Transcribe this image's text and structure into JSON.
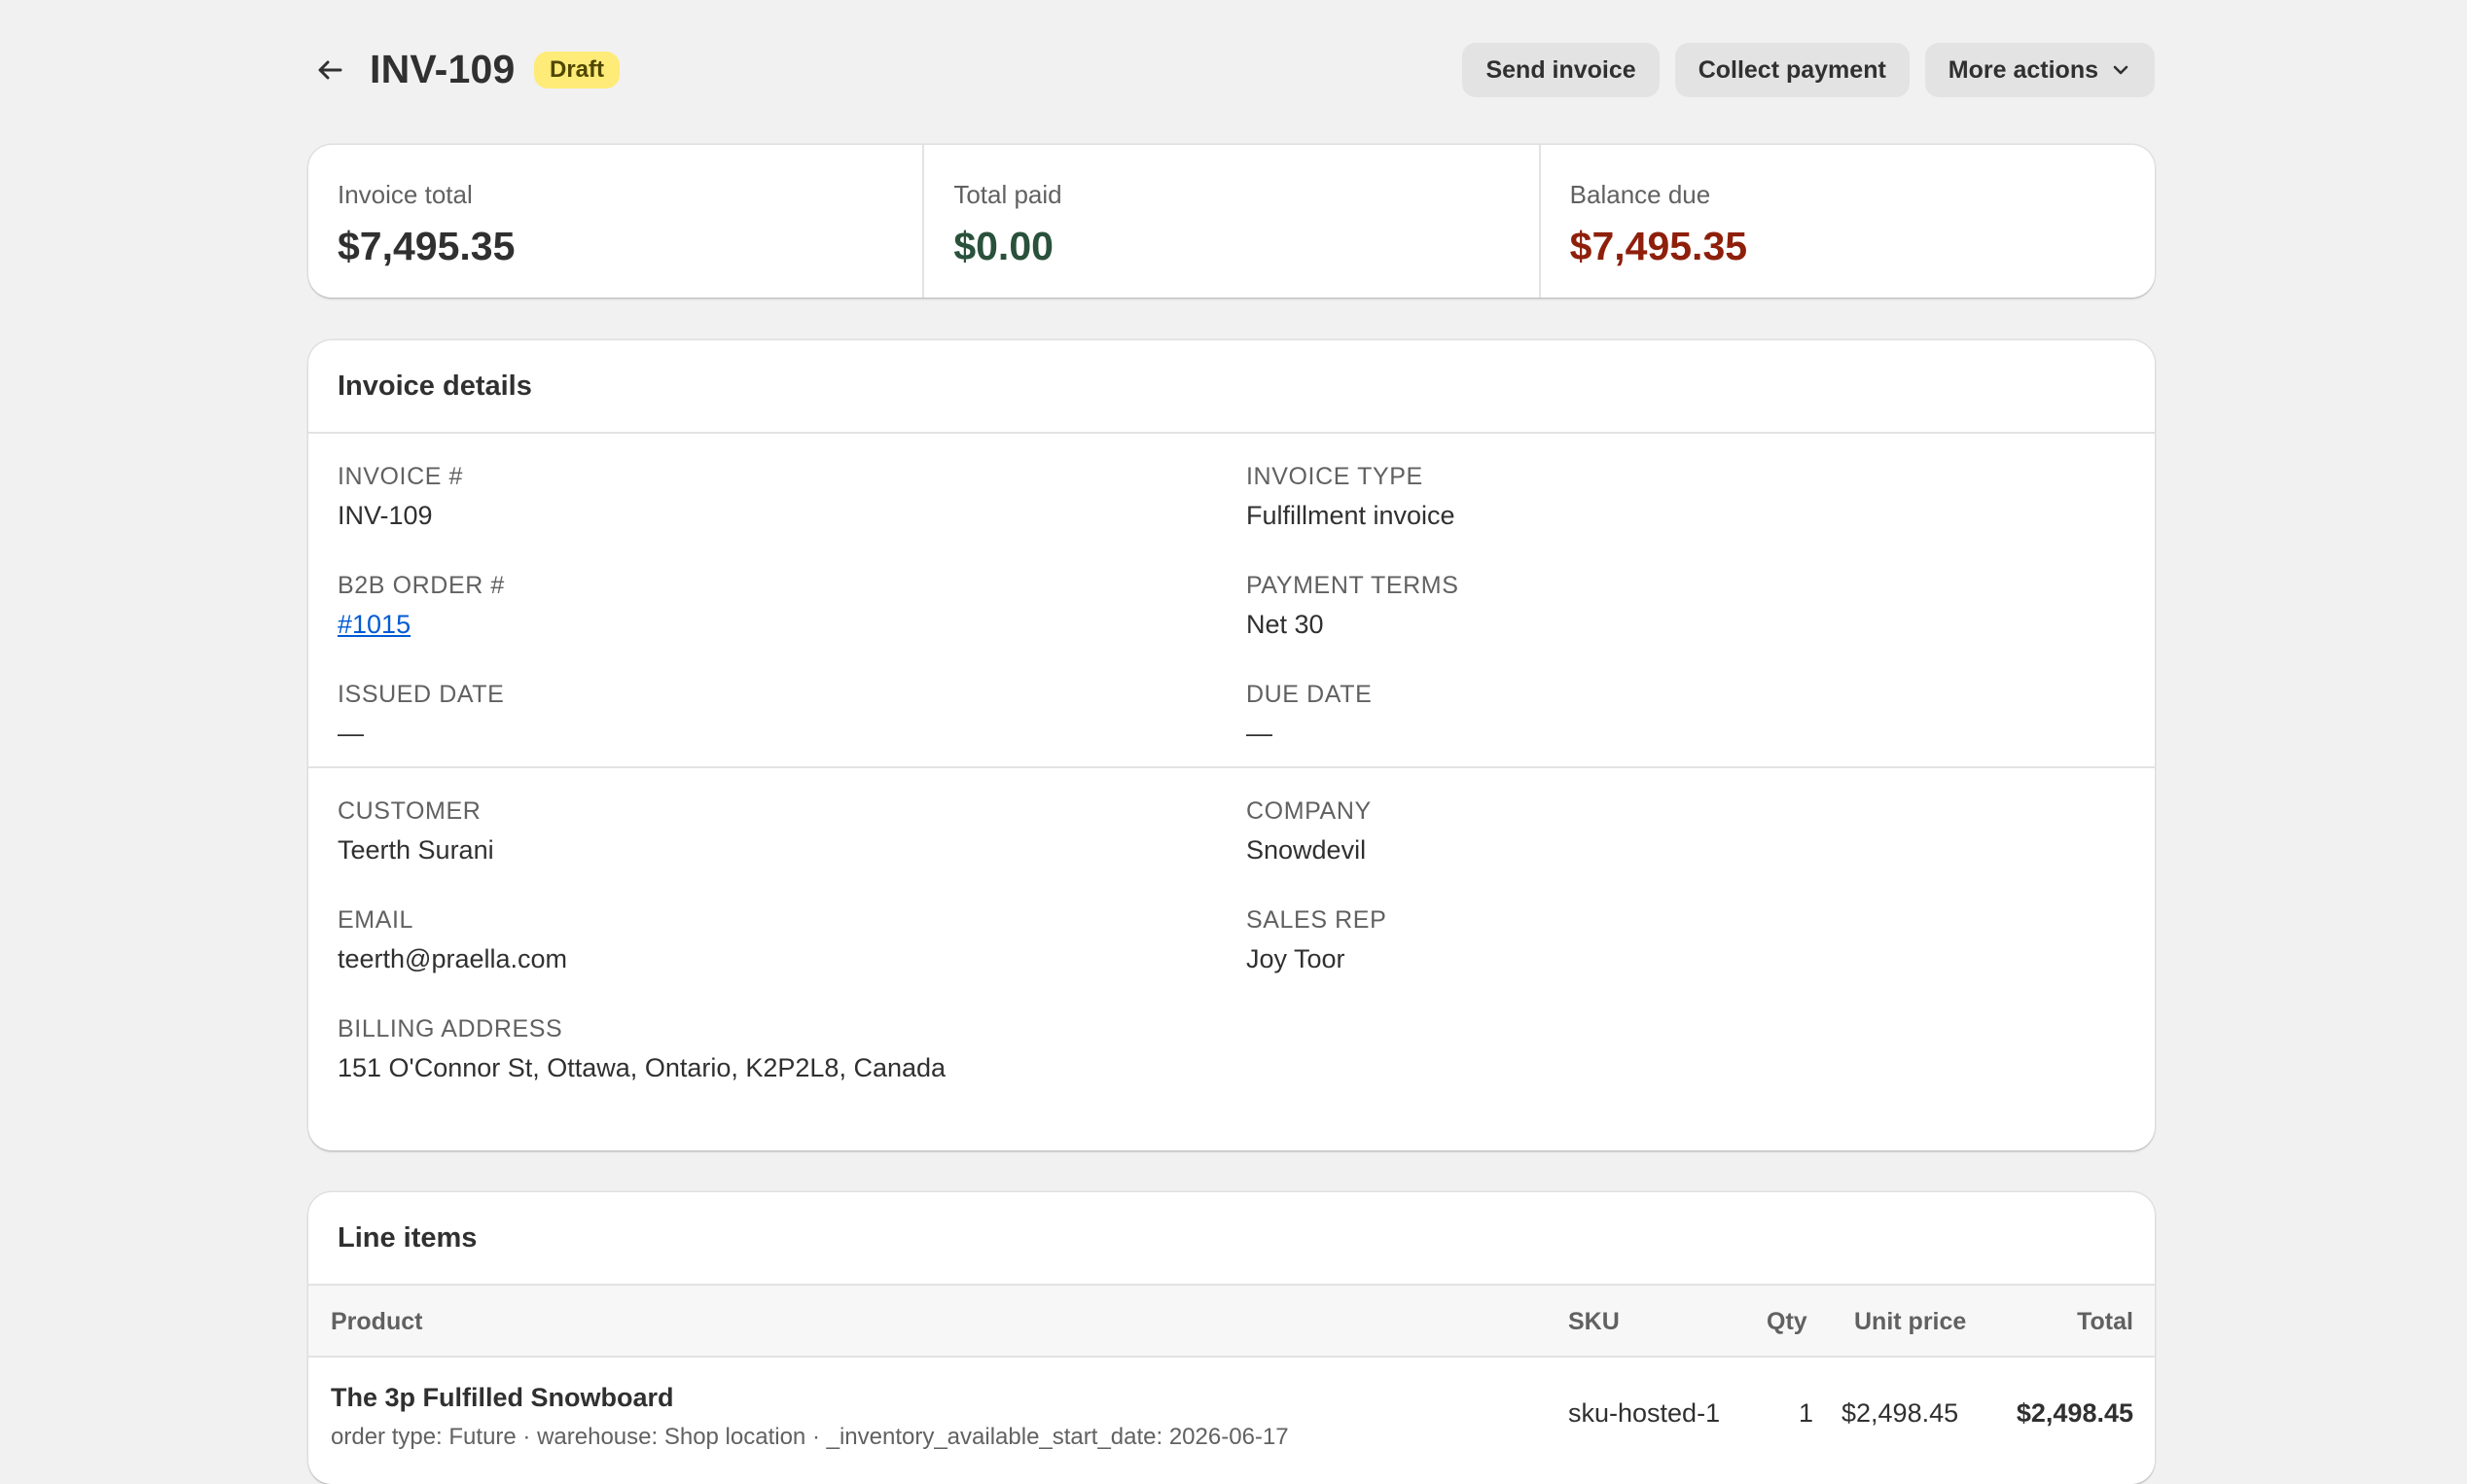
{
  "header": {
    "title": "INV-109",
    "status_badge": "Draft",
    "actions": {
      "send_invoice": "Send invoice",
      "collect_payment": "Collect payment",
      "more_actions": "More actions"
    }
  },
  "summary": {
    "invoice_total_label": "Invoice total",
    "invoice_total_value": "$7,495.35",
    "total_paid_label": "Total paid",
    "total_paid_value": "$0.00",
    "balance_due_label": "Balance due",
    "balance_due_value": "$7,495.35"
  },
  "details": {
    "title": "Invoice details",
    "invoice_number_label": "INVOICE #",
    "invoice_number": "INV-109",
    "invoice_type_label": "INVOICE TYPE",
    "invoice_type": "Fulfillment invoice",
    "b2b_order_label": "B2B ORDER #",
    "b2b_order": "#1015",
    "payment_terms_label": "PAYMENT TERMS",
    "payment_terms": "Net 30",
    "issued_date_label": "ISSUED DATE",
    "issued_date": "—",
    "due_date_label": "DUE DATE",
    "due_date": "—",
    "customer_label": "CUSTOMER",
    "customer": "Teerth Surani",
    "company_label": "COMPANY",
    "company": "Snowdevil",
    "email_label": "EMAIL",
    "email": "teerth@praella.com",
    "sales_rep_label": "SALES REP",
    "sales_rep": "Joy Toor",
    "billing_address_label": "BILLING ADDRESS",
    "billing_address": "151 O'Connor St, Ottawa, Ontario, K2P2L8, Canada"
  },
  "line_items": {
    "title": "Line items",
    "columns": {
      "product": "Product",
      "sku": "SKU",
      "qty": "Qty",
      "unit_price": "Unit price",
      "total": "Total"
    },
    "rows": [
      {
        "product": "The 3p Fulfilled Snowboard",
        "meta": "order type: Future · warehouse: Shop location · _inventory_available_start_date: 2026-06-17",
        "sku": "sku-hosted-1",
        "qty": "1",
        "unit_price": "$2,498.45",
        "total": "$2,498.45"
      }
    ]
  },
  "colors": {
    "background": "#f1f1f1",
    "badge_draft": "#ffeb78",
    "paid_green": "#29513b",
    "due_red": "#8e1f0b",
    "link_blue": "#005bd3"
  },
  "icons": {
    "back": "arrow-left-icon",
    "more_actions": "chevron-down-icon"
  }
}
